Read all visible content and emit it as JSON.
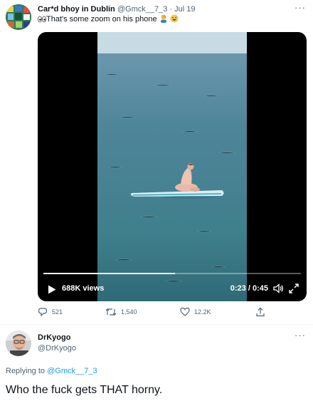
{
  "tweet": {
    "author_name": "Car*d bhoy in Dublin",
    "handle": "@Gmck__7_3",
    "separator": "·",
    "date": "Jul 19",
    "more": "···",
    "text": "That's some zoom on his phone",
    "emoji": [
      "eyes-icon",
      "person-facepalming-icon",
      "grinning-sweat-icon"
    ],
    "video": {
      "views": "688K views",
      "current_time": "0:23",
      "duration": "0:45",
      "time_separator": " / ",
      "progress": 0.51
    },
    "actions": {
      "replies": "521",
      "retweets": "1,540",
      "likes": "12.2K"
    }
  },
  "reply": {
    "author_name": "DrKyogo",
    "handle": "@DrKyogo",
    "more": "···",
    "replying_prefix": "Replying to",
    "replying_to": "@Gmck__7_3",
    "text": "Who the fuck gets THAT horny."
  },
  "colors": {
    "text_primary": "#0f1419",
    "text_secondary": "#536471",
    "accent": "#1d9bf0",
    "divider": "#eff3f4"
  }
}
